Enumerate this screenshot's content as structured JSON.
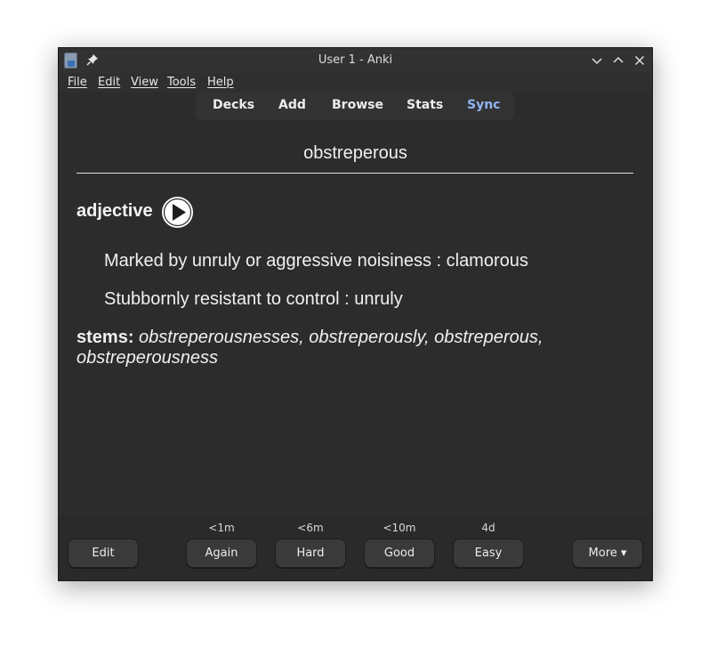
{
  "window": {
    "title": "User 1 - Anki"
  },
  "menubar": {
    "items": [
      "File",
      "Edit",
      "View",
      "Tools",
      "Help"
    ]
  },
  "toolbar": {
    "items": [
      "Decks",
      "Add",
      "Browse",
      "Stats",
      "Sync"
    ]
  },
  "card": {
    "word": "obstreperous",
    "part_of_speech": "adjective",
    "definitions": [
      "Marked by unruly or aggressive noisiness : clamorous",
      "Stubbornly resistant to control : unruly"
    ],
    "stems_label": "stems:",
    "stems_line1": "obstreperousnesses, obstreperously, obstreperous,",
    "stems_line2": "obstreperousness"
  },
  "reviewer": {
    "edit_label": "Edit",
    "more_label": "More ▾",
    "answers": [
      {
        "label": "Again",
        "interval": "<1m"
      },
      {
        "label": "Hard",
        "interval": "<6m"
      },
      {
        "label": "Good",
        "interval": "<10m"
      },
      {
        "label": "Easy",
        "interval": "4d"
      }
    ]
  },
  "icons": [
    "anki-app-icon",
    "pin-icon",
    "minimize-icon",
    "maximize-icon",
    "close-icon",
    "play-audio-icon"
  ],
  "colors": {
    "background": "#2c2c2c",
    "sync_accent": "#8fb4f0",
    "text": "#f0f0f0"
  }
}
